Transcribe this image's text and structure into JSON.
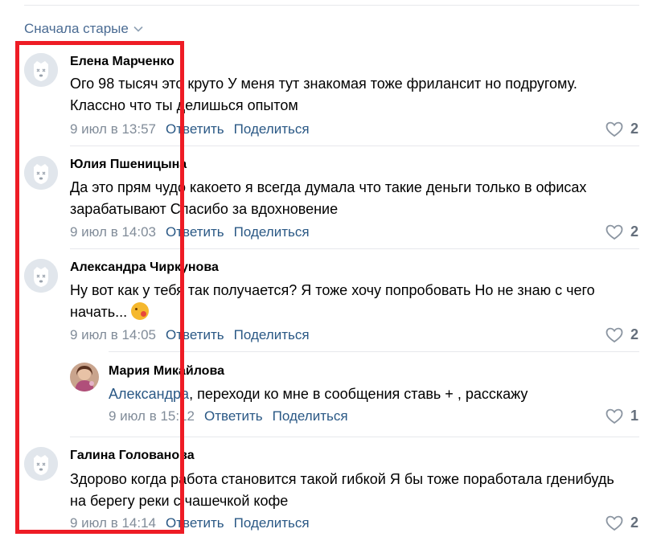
{
  "sort": {
    "label": "Сначала старые"
  },
  "actions": {
    "reply": "Ответить",
    "share": "Поделиться"
  },
  "comments": [
    {
      "author": "Елена Марченко",
      "text": "Ого 98 тысяч это круто У меня тут знакомая тоже фрилансит но подругому. Классно что ты делишься опытом",
      "time": "9 июл в 13:57",
      "likes": "2",
      "avatar": "deactivated-dog-icon"
    },
    {
      "author": "Юлия Пшеницына",
      "text": "Да это прям чудо какоето я всегда думала что такие деньги только в офисах зарабатывают Спасибо за вдохновение",
      "time": "9 июл в 14:03",
      "likes": "2",
      "avatar": "deactivated-dog-icon"
    },
    {
      "author": "Александра Чиркунова",
      "text": "Ну вот как у тебя так получается? Я тоже хочу попробовать Но не знаю с чего начать...",
      "time": "9 июл в 14:05",
      "likes": "2",
      "avatar": "deactivated-dog-icon",
      "emoji": "kiss-emoji"
    },
    {
      "author": "Мария Микайлова",
      "mention": "Александра",
      "text": ", переходи ко мне в сообщения ставь + , расскажу",
      "time": "9 июл в 15:12",
      "likes": "1",
      "avatar": "user-photo"
    },
    {
      "author": "Галина Голованова",
      "text": "Здорово когда работа становится такой гибкой Я бы тоже поработала гденибудь на берегу реки с чашечкой кофе",
      "time": "9 июл в 14:14",
      "likes": "2",
      "avatar": "deactivated-dog-icon"
    }
  ],
  "colors": {
    "link": "#2a5885",
    "meta": "#818c99",
    "highlight_box": "#ee1c25",
    "divider": "#e7e8ec"
  }
}
